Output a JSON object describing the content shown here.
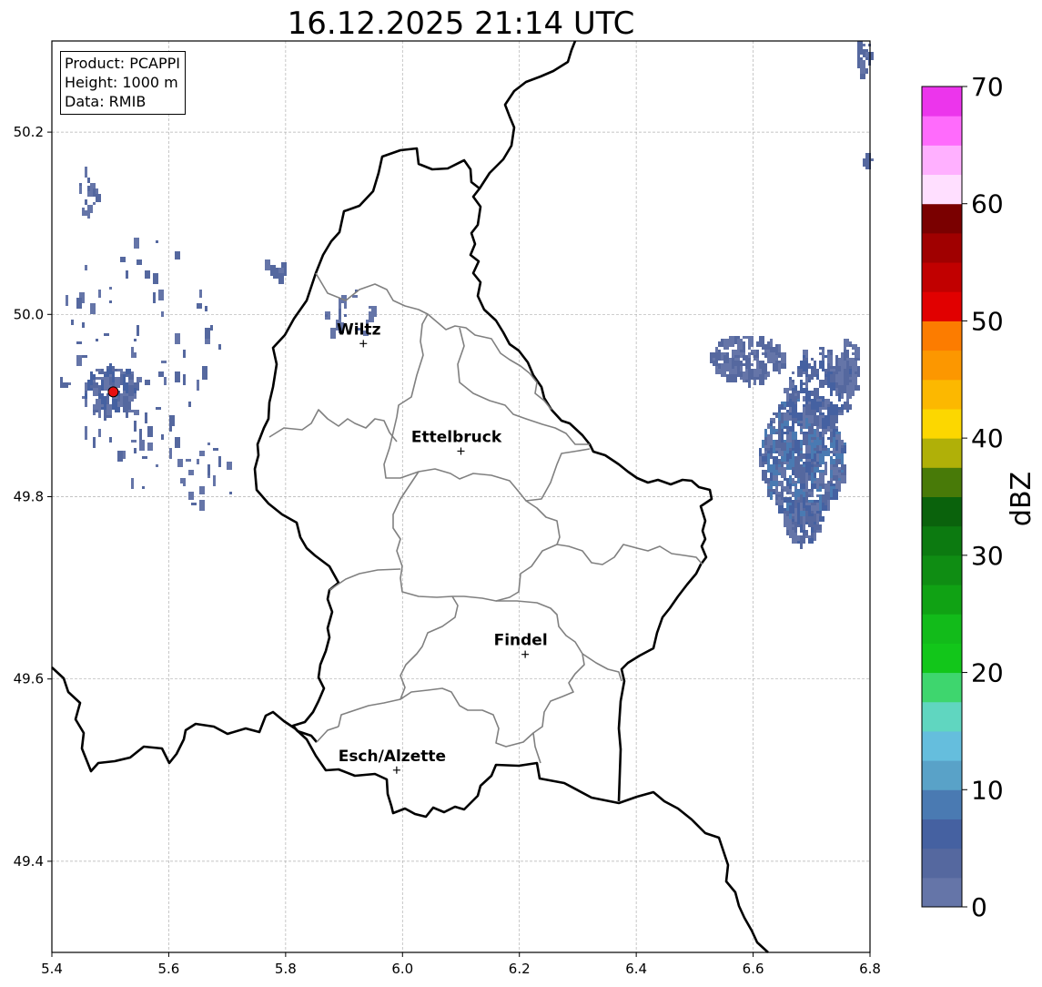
{
  "title": "16.12.2025 21:14 UTC",
  "info": {
    "product": "Product: PCAPPI",
    "height": "Height: 1000 m",
    "data": "Data: RMIB"
  },
  "axes": {
    "xlim": [
      5.4,
      6.8
    ],
    "ylim": [
      49.3,
      50.3
    ],
    "xticks": [
      "5.4",
      "5.6",
      "5.8",
      "6.0",
      "6.2",
      "6.4",
      "6.6",
      "6.8"
    ],
    "yticks": [
      "49.4",
      "49.6",
      "49.8",
      "50.0",
      "50.2"
    ],
    "grid": true
  },
  "cities": [
    {
      "name": "Wiltz",
      "lon": 5.933,
      "lat": 49.968
    },
    {
      "name": "Ettelbruck",
      "lon": 6.1,
      "lat": 49.85
    },
    {
      "name": "Findel",
      "lon": 6.21,
      "lat": 49.627
    },
    {
      "name": "Esch/Alzette",
      "lon": 5.99,
      "lat": 49.5
    }
  ],
  "radar_site": {
    "lon": 5.505,
    "lat": 49.915,
    "color": "#e81010"
  },
  "colorbar": {
    "label": "dBZ",
    "min": 0,
    "max": 70,
    "ticks": [
      "0",
      "10",
      "20",
      "30",
      "40",
      "50",
      "60",
      "70"
    ],
    "colors": [
      "#6575a8",
      "#55689f",
      "#4561a1",
      "#4a7ab2",
      "#59a2c8",
      "#65bedd",
      "#60d6c0",
      "#3ed66e",
      "#12c61a",
      "#12bb1a",
      "#10a214",
      "#0f8d13",
      "#0c7a10",
      "#0a620c",
      "#487a08",
      "#b0b008",
      "#fcd700",
      "#fcb800",
      "#fc9700",
      "#fc7c00",
      "#e10000",
      "#c10000",
      "#a00000",
      "#7a0000",
      "#ffdfff",
      "#ffb0ff",
      "#ff6bfc",
      "#ec35ec"
    ]
  }
}
